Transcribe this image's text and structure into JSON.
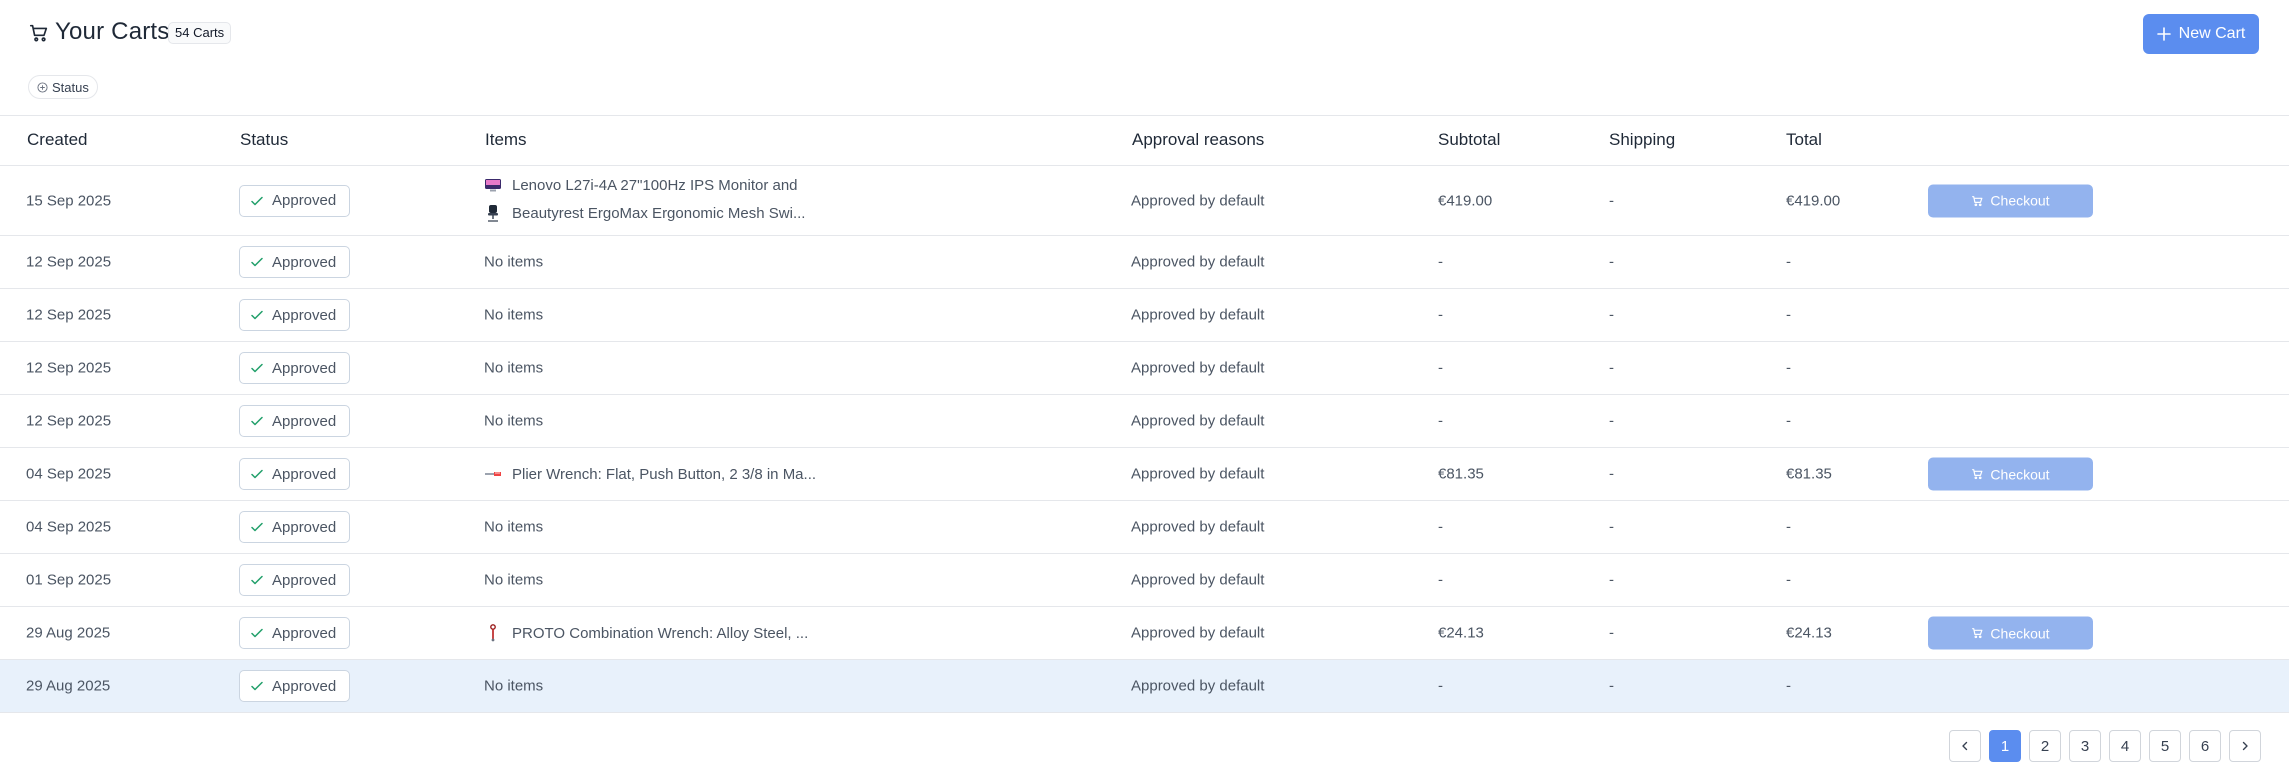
{
  "header": {
    "title": "Your Carts",
    "count_badge": "54 Carts",
    "new_cart_label": "New Cart"
  },
  "filters": {
    "status_label": "Status"
  },
  "table": {
    "columns": [
      "Created",
      "Status",
      "Items",
      "Approval reasons",
      "Subtotal",
      "Shipping",
      "Total"
    ],
    "rows": [
      {
        "created": "15 Sep 2025",
        "status": "Approved",
        "items": [
          "Lenovo L27i-4A 27\"100Hz IPS Monitor and",
          "Beautyrest ErgoMax Ergonomic Mesh Swi..."
        ],
        "reason": "Approved by default",
        "subtotal": "€419.00",
        "shipping": "-",
        "total": "€419.00",
        "checkout": "Checkout"
      },
      {
        "created": "12 Sep 2025",
        "status": "Approved",
        "items": [
          "No items"
        ],
        "reason": "Approved by default",
        "subtotal": "-",
        "shipping": "-",
        "total": "-",
        "checkout": ""
      },
      {
        "created": "12 Sep 2025",
        "status": "Approved",
        "items": [
          "No items"
        ],
        "reason": "Approved by default",
        "subtotal": "-",
        "shipping": "-",
        "total": "-",
        "checkout": ""
      },
      {
        "created": "12 Sep 2025",
        "status": "Approved",
        "items": [
          "No items"
        ],
        "reason": "Approved by default",
        "subtotal": "-",
        "shipping": "-",
        "total": "-",
        "checkout": ""
      },
      {
        "created": "12 Sep 2025",
        "status": "Approved",
        "items": [
          "No items"
        ],
        "reason": "Approved by default",
        "subtotal": "-",
        "shipping": "-",
        "total": "-",
        "checkout": ""
      },
      {
        "created": "04 Sep 2025",
        "status": "Approved",
        "items": [
          "Plier Wrench: Flat, Push Button, 2 3/8 in Ma..."
        ],
        "reason": "Approved by default",
        "subtotal": "€81.35",
        "shipping": "-",
        "total": "€81.35",
        "checkout": "Checkout"
      },
      {
        "created": "04 Sep 2025",
        "status": "Approved",
        "items": [
          "No items"
        ],
        "reason": "Approved by default",
        "subtotal": "-",
        "shipping": "-",
        "total": "-",
        "checkout": ""
      },
      {
        "created": "01 Sep 2025",
        "status": "Approved",
        "items": [
          "No items"
        ],
        "reason": "Approved by default",
        "subtotal": "-",
        "shipping": "-",
        "total": "-",
        "checkout": ""
      },
      {
        "created": "29 Aug 2025",
        "status": "Approved",
        "items": [
          "PROTO Combination Wrench: Alloy Steel, ..."
        ],
        "reason": "Approved by default",
        "subtotal": "€24.13",
        "shipping": "-",
        "total": "€24.13",
        "checkout": "Checkout"
      },
      {
        "created": "29 Aug 2025",
        "status": "Approved",
        "items": [
          "No items"
        ],
        "reason": "Approved by default",
        "subtotal": "-",
        "shipping": "-",
        "total": "-",
        "checkout": ""
      }
    ]
  },
  "pagination": {
    "pages": [
      "1",
      "2",
      "3",
      "4",
      "5",
      "6"
    ],
    "current": "1"
  },
  "colors": {
    "accent": "#5b8def",
    "checkout_button": "#93b3ee",
    "approved_check": "#22a06b",
    "selected_row": "#e8f1fb"
  },
  "icons": {
    "title": "shopping-cart-icon",
    "new_cart": "plus-icon",
    "status_filter": "plus-circle-icon",
    "status": "check-icon",
    "checkout": "shopping-cart-icon",
    "prev": "chevron-left-icon",
    "next": "chevron-right-icon"
  }
}
